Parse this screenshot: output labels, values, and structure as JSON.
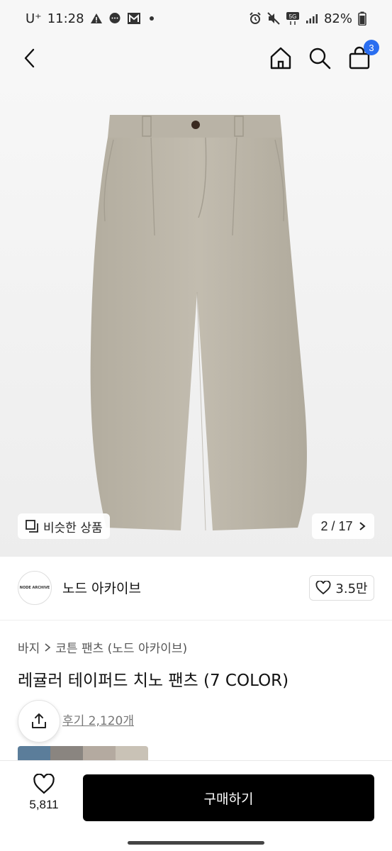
{
  "status_bar": {
    "carrier": "U⁺",
    "time": "11:28",
    "network": "5G",
    "battery": "82%",
    "left_icons": [
      "warning-icon",
      "message-icon",
      "gmail-icon",
      "dot-icon"
    ],
    "right_icons": [
      "alarm-icon",
      "mute-icon",
      "network-5g-icon",
      "signal-icon",
      "battery-icon"
    ]
  },
  "nav": {
    "cart_count": "3",
    "icons": [
      "back-arrow-icon",
      "home-icon",
      "search-icon",
      "shopping-bag-icon"
    ]
  },
  "image": {
    "similar_label": "비슷한 상품",
    "counter": "2 / 17",
    "product_color": "#bcb6a9"
  },
  "brand": {
    "logo_text": "NODE ARCHIVE",
    "name": "노드 아카이브",
    "likes": "3.5만"
  },
  "product": {
    "breadcrumb": [
      "바지",
      "코튼 팬츠 (노드 아카이브)"
    ],
    "title": "레귤러 테이퍼드 치노 팬츠 (7 COLOR)",
    "review_text": "후기 2,120개"
  },
  "bottom_bar": {
    "wish_count": "5,811",
    "buy_label": "구매하기"
  },
  "colors": {
    "accent": "#2a6ef0",
    "buy_button": "#000000"
  }
}
